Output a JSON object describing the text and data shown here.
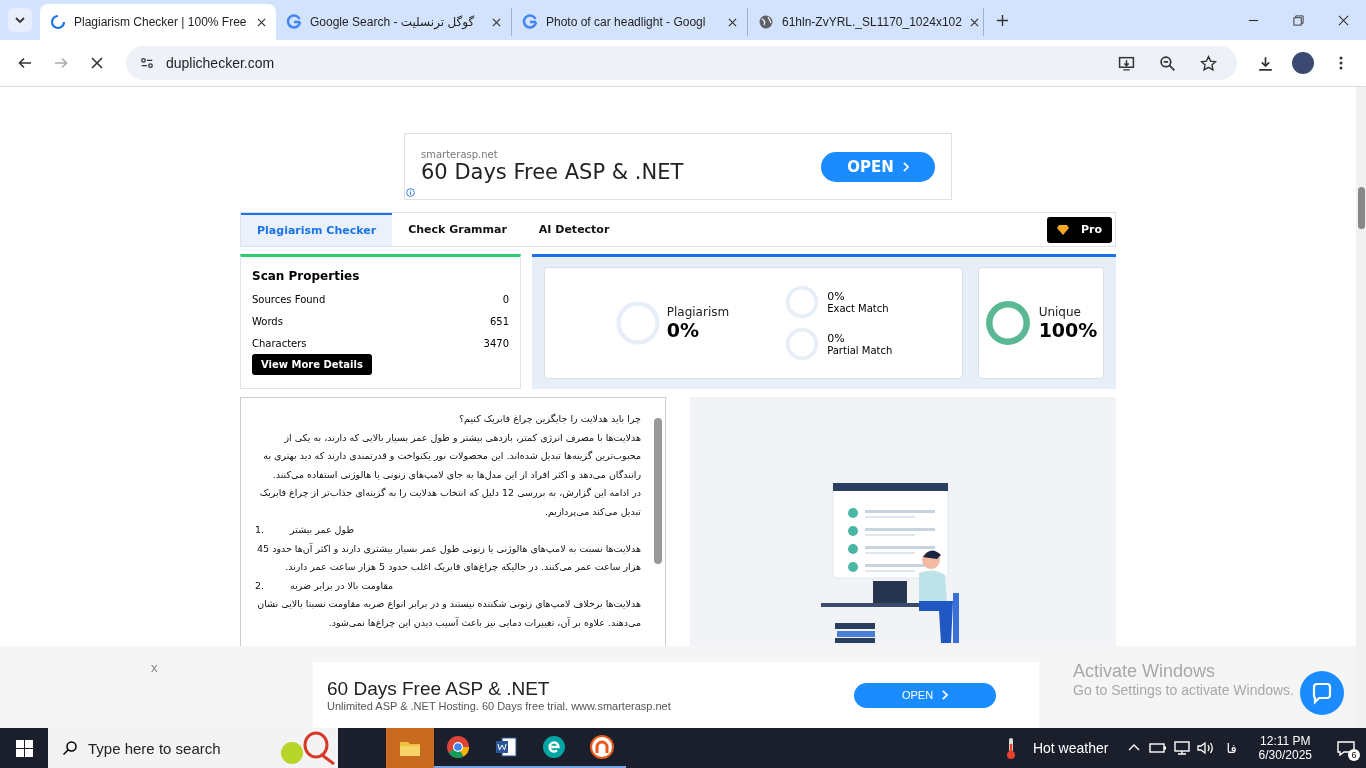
{
  "browser": {
    "tabs": [
      {
        "title": "Plagiarism Checker | 100% Free",
        "selected": true
      },
      {
        "title": "Google Search - گوگل ترنسلیت",
        "selected": false
      },
      {
        "title": "Photo of car headlight - Googl",
        "selected": false
      },
      {
        "title": "61hln-ZvYRL._SL1170_1024x102",
        "selected": false
      }
    ],
    "url": "duplichecker.com"
  },
  "ad_banner": {
    "source": "smarterasp.net",
    "headline": "60 Days Free ASP & .NET",
    "button": "OPEN"
  },
  "tool_tabs": [
    {
      "label": "Plagiarism Checker",
      "selected": true
    },
    {
      "label": "Check Grammar",
      "selected": false
    },
    {
      "label": "AI Detector",
      "selected": false
    }
  ],
  "pro_button": "Pro",
  "scan_properties": {
    "title": "Scan Properties",
    "rows": [
      {
        "label": "Sources Found",
        "value": "0"
      },
      {
        "label": "Words",
        "value": "651"
      },
      {
        "label": "Characters",
        "value": "3470"
      }
    ],
    "button": "View More Details"
  },
  "results": {
    "plagiarism": {
      "label": "Plagiarism",
      "value": "0%"
    },
    "exact_match": {
      "value": "0%",
      "label": "Exact Match"
    },
    "partial_match": {
      "value": "0%",
      "label": "Partial Match"
    },
    "unique": {
      "label": "Unique",
      "value": "100%"
    }
  },
  "text_box": {
    "paragraphs": [
      {
        "kind": "para",
        "text": "چرا باید هدلایت را جایگزین چراغ فابریک کنیم؟"
      },
      {
        "kind": "para",
        "text": "هدلایت‌ها با مصرف انرژی کمتر، بازدهی بیشتر و طول عمر بسیار بالایی که دارند، به یکی از محبوب‌ترین گزینه‌ها تبدیل شده‌اند. این محصولات نور یکنواخت و قدرتمندی دارند که دید بهتری به رانندگان می‌دهد و اکثر افراد از این مدل‌ها به جای لامپ‌های زنونی یا هالوژنی استفاده می‌کنند."
      },
      {
        "kind": "para",
        "text": "در ادامه این گزارش، به بررسی 12 دلیل که انتخاب هدلایت را به گزینه‌ای جذاب‌تر از چراغ فابریک تبدیل می‌کند می‌پردازیم."
      },
      {
        "kind": "heading",
        "number": "1.",
        "text": "طول عمر بیشتر"
      },
      {
        "kind": "para",
        "text": "هدلایت‌ها نسبت به لامپ‌های هالوژنی یا زنونی طول عمر بسیار بیشتری دارند و اکثر آن‌ها حدود 45 هزار ساعت عمر می‌کنند. در حالیکه چراغ‌های فابریک اغلب حدود 5 هزار ساعت عمر دارند."
      },
      {
        "kind": "heading",
        "number": "2.",
        "text": "مقاومت بالا در برابر ضربه"
      },
      {
        "kind": "para",
        "text": "هدلایت‌ها برخلاف لامپ‌های زنونی شکننده نیستند و در برابر انواع ضربه مقاومت نسبتا بالایی نشان می‌دهند. علاوه بر آن، تغییرات دمایی نیز باعث آسیب دیدن این چراغ‌ها نمی‌شود."
      }
    ]
  },
  "bottom_ad": {
    "close": "x",
    "headline": "60 Days Free ASP & .NET",
    "subline": "Unlimited ASP & .NET Hosting. 60 Days free trial. www.smarterasp.net",
    "button": "OPEN"
  },
  "activation": {
    "title": "Activate Windows",
    "subtitle": "Go to Settings to activate Windows."
  },
  "taskbar": {
    "search_placeholder": "Type here to search",
    "weather": "Hot weather",
    "language": "فا",
    "time": "12:11 PM",
    "date": "6/30/2025",
    "notifications": "6"
  }
}
